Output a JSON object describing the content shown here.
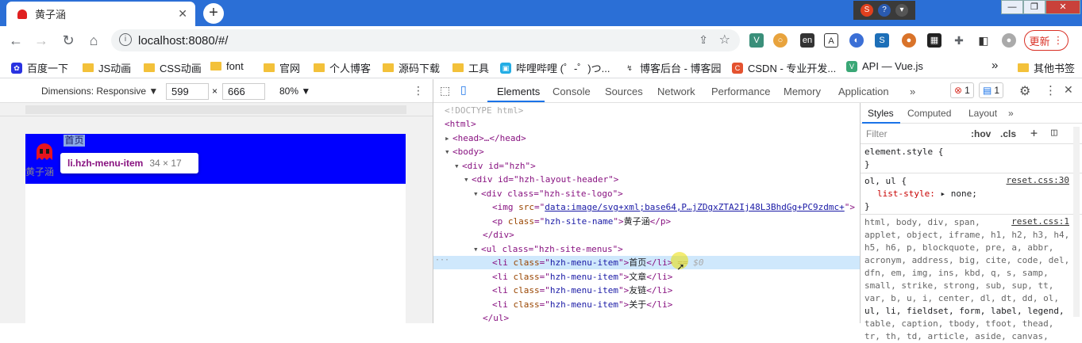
{
  "browser": {
    "tab_title": "黄子涵",
    "new_tab": "+",
    "url": "localhost:8080/#/",
    "update_label": "更新",
    "bookmarks": [
      {
        "label": "百度一下",
        "kind": "baidu-icon"
      },
      {
        "label": "JS动画",
        "kind": "folder-icon"
      },
      {
        "label": "CSS动画",
        "kind": "folder-icon"
      },
      {
        "label": "font",
        "kind": "folder-icon"
      },
      {
        "label": "官网",
        "kind": "folder-icon"
      },
      {
        "label": "个人博客",
        "kind": "folder-icon"
      },
      {
        "label": "源码下载",
        "kind": "folder-icon"
      },
      {
        "label": "工具",
        "kind": "folder-icon"
      },
      {
        "label": "哔哩哔哩 (゜-゜)つ...",
        "kind": "bilibili-icon"
      },
      {
        "label": "博客后台 - 博客园",
        "kind": "cnblogs-icon"
      },
      {
        "label": "CSDN - 专业开发...",
        "kind": "csdn-icon"
      },
      {
        "label": "API — Vue.js",
        "kind": "vue-icon"
      },
      {
        "label": "»",
        "kind": "more"
      },
      {
        "label": "其他书签",
        "kind": "folder-icon"
      }
    ]
  },
  "device": {
    "dimensions_label": "Dimensions: Responsive ▼",
    "width": "599",
    "times": "×",
    "height": "666",
    "zoom": "80% ▼"
  },
  "preview": {
    "site_name": "黄子涵",
    "menu_item": "首页",
    "tooltip_selector": "li.hzh-menu-item",
    "tooltip_size": "34 × 17"
  },
  "devtools": {
    "tabs": [
      "Elements",
      "Console",
      "Sources",
      "Network",
      "Performance",
      "Memory",
      "Application",
      "»"
    ],
    "error_count": "1",
    "message_count": "1",
    "dom_lines": [
      "<!DOCTYPE html>",
      "<html>",
      "<head>…</head>",
      "<body>",
      "<div id=\"hzh\">",
      "<div id=\"hzh-layout-header\">",
      "<div class=\"hzh-site-logo\">",
      "data:image/svg+xml;base64,P…jZDgxZTA2Ij48L3BhdGg+PC9zdmc+",
      "黄子涵",
      "</div>",
      "<ul class=\"hzh-site-menus\">",
      "首页",
      "== $0",
      "文章",
      "友链",
      "关于",
      "</ul>"
    ],
    "styles_tabs": [
      "Styles",
      "Computed",
      "Layout",
      "»"
    ],
    "filter_placeholder": "Filter",
    "hov": ":hov",
    "cls": ".cls",
    "rules": {
      "element_style": "element.style {",
      "close": "}",
      "ol_ul": "ol, ul {",
      "ol_ul_src": "reset.css:30",
      "list_style": "list-style:",
      "list_style_val": "none;",
      "reset_src": "reset.css:1",
      "reset_lines": [
        "html, body, div, span,",
        "applet, object, iframe, h1, h2, h3, h4,",
        "h5, h6, p, blockquote, pre, a, abbr,",
        "acronym, address, big, cite, code, del,",
        "dfn, em, img, ins, kbd, q, s, samp,",
        "small, strike, strong, sub, sup, tt,",
        "var, b, u, i, center, dl, dt, dd, ol,",
        "ul, li, fieldset, form, label, legend,",
        "table, caption, tbody, tfoot, thead,",
        "tr, th, td, article, aside, canvas,"
      ]
    }
  },
  "colors": {
    "titlebar": "#2b6fd6",
    "header_blue": "#0000ff",
    "accent": "#1a73e8",
    "error": "#d93025"
  }
}
